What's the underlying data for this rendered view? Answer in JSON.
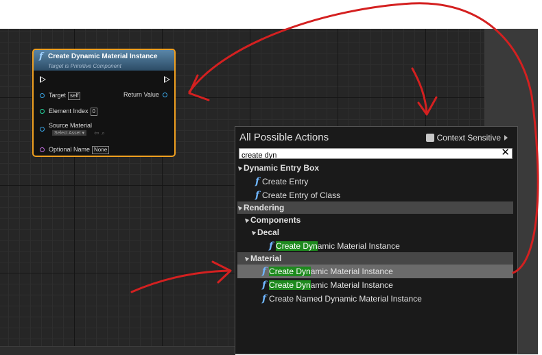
{
  "node": {
    "title": "Create Dynamic Material Instance",
    "subtitle": "Target is Primitive Component",
    "pins": {
      "target_label": "Target",
      "target_value": "self",
      "return_label": "Return Value",
      "element_index_label": "Element Index",
      "element_index_value": "0",
      "source_material_label": "Source Material",
      "source_material_value": "Select Asset",
      "optional_name_label": "Optional Name",
      "optional_name_value": "None"
    }
  },
  "menu": {
    "title": "All Possible Actions",
    "context_sensitive_label": "Context Sensitive",
    "search_value": "create dyn",
    "clear_icon": "close-icon",
    "items": [
      {
        "kind": "category",
        "label": "Dynamic Entry Box"
      },
      {
        "kind": "action",
        "label": "Create Entry"
      },
      {
        "kind": "action",
        "label": "Create Entry of Class"
      },
      {
        "kind": "category",
        "label": "Rendering"
      },
      {
        "kind": "category",
        "label": "Components"
      },
      {
        "kind": "category",
        "label": "Decal"
      },
      {
        "kind": "action",
        "match": "Create Dyn",
        "rest": "amic Material Instance"
      },
      {
        "kind": "category",
        "label": "Material"
      },
      {
        "kind": "action",
        "match": "Create Dyn",
        "rest": "amic Material Instance",
        "selected": true
      },
      {
        "kind": "action",
        "match": "Create Dyn",
        "rest": "amic Material Instance"
      },
      {
        "kind": "action",
        "label": "Create Named Dynamic Material Instance"
      }
    ]
  },
  "colors": {
    "graph_bg": "#262626",
    "node_border": "#f0a020",
    "node_header": "#3d6585",
    "highlight": "#1e8a1e",
    "annotation": "#d42020"
  }
}
